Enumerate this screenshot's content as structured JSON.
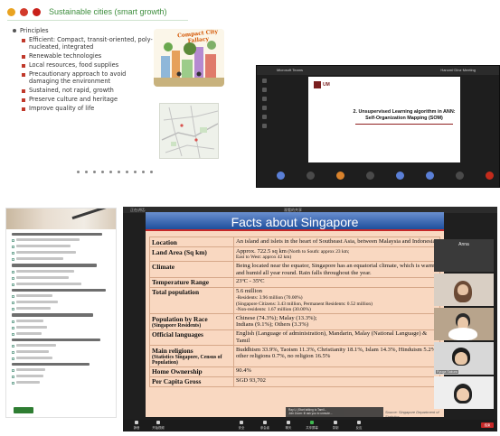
{
  "slide1": {
    "title": "Sustainable cities (smart growth)",
    "section": "Principles",
    "items": [
      "Efficient: Compact, transit-oriented, poly-nucleated, integrated",
      "Renewable technologies",
      "Local resources, food supplies",
      "Precautionary approach to avoid damaging the environment",
      "Sustained, not rapid, growth",
      "Preserve culture and heritage",
      "Improve quality of life"
    ],
    "illustration_text": "Compact City Fallacy",
    "window_dot_colors": [
      "#e9a321",
      "#d23a2b",
      "#c9201a"
    ],
    "title_color": "#3d8d3d"
  },
  "teams": {
    "app_name": "Microsoft Teams",
    "user_label": "Hanomi·Dinz·Meeting",
    "logo_text": "UM",
    "slide_heading_line1": "2. Unsupervised Learning algorithm in ANN:",
    "slide_heading_line2": "Self-Organization Mapping (SOM)"
  },
  "zoom": {
    "top_label": "正在讲话:",
    "top_label2": "观看的共享",
    "slide_title": "Facts about Singapore",
    "accent_color": "#1e4f9d",
    "table_bg": "#f9d8c1",
    "rows": [
      {
        "key": "Location",
        "value": "An island and islets in the heart of Southeast Asia, between Malaysia and Indonesia"
      },
      {
        "key": "Land Area (Sq km)",
        "value": "Approx. 722.5 sq km",
        "value_small_inline": " (North to South: approx 23 km;",
        "value_small": "East to West: approx 42 km)"
      },
      {
        "key": "Climate",
        "value": "Being located near the equator, Singapore has an equatorial climate, which is warm and humid all year round. Rain falls throughout the year."
      },
      {
        "key": "Temperature Range",
        "value": "23ºC - 35ºC"
      },
      {
        "key": "Total population",
        "value": "5.6 million",
        "lines": [
          "-Residents: 3.96 million (70.00%)",
          "(Singapore Citizens: 3.43 million, Permanent Residents: 0.52 million)",
          "-Non-residents: 1.67 million (30.00%)"
        ]
      },
      {
        "key": "Population by Race",
        "key_sub": "(Singapore Residents)",
        "value": "Chinese (74.3%); Malay (13.3%);",
        "value2": "Indians (9.1%); Others (3.3%)"
      },
      {
        "key": "Official languages",
        "value": "English (Language of administration), Mandarin, Malay (National Language) & Tamil"
      },
      {
        "key": "Main religions",
        "key_sub": "(Statistics Singapore, Census of Population)",
        "value": "Buddhism 33.9%, Taoism 11.3%, Christianity 18.1%, Islam 14.3%, Hinduism 5.2%, other religions 0.7%, no religion 16.5%"
      },
      {
        "key": "Home Ownership",
        "value": "90.4%"
      },
      {
        "key": "Per Capita Gross",
        "value": "SGD 93,702"
      }
    ],
    "chat_popup": [
      "Ray Li (Start talking to Tamil...",
      "Join Zoom: Ill ask you to unmute..."
    ],
    "source_note": "Source: Singapore Department of Statistics",
    "participants": [
      {
        "name": "Anna",
        "label": "Anna"
      },
      {
        "name": ""
      },
      {
        "name": ""
      },
      {
        "name": "Ryuga Sakura"
      },
      {
        "name": ""
      }
    ],
    "toolbar": [
      {
        "label": "静音",
        "icon": "mic-icon"
      },
      {
        "label": "开始视频",
        "icon": "video-icon"
      },
      {
        "label": "安全",
        "icon": "shield-icon"
      },
      {
        "label": "参会者",
        "icon": "people-icon"
      },
      {
        "label": "聊天",
        "icon": "chat-icon"
      },
      {
        "label": "共享屏幕",
        "icon": "share-icon",
        "green": true
      },
      {
        "label": "录制",
        "icon": "record-icon"
      },
      {
        "label": "反应",
        "icon": "reaction-icon"
      }
    ],
    "end_label": "结束"
  }
}
